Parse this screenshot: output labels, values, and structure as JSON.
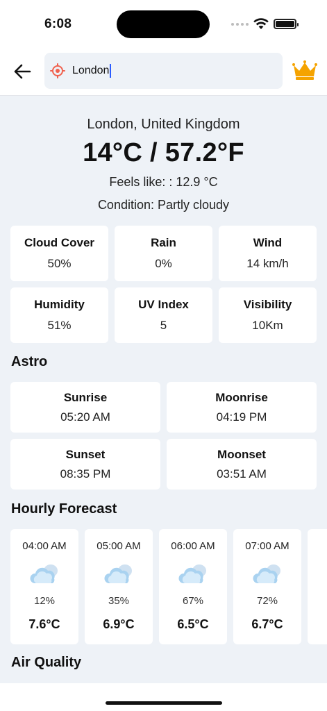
{
  "status": {
    "time": "6:08"
  },
  "search": {
    "value": "London"
  },
  "icons": {
    "back": "back-arrow-icon",
    "location": "location-target-icon",
    "crown": "crown-icon",
    "wifi": "wifi-icon",
    "battery": "battery-icon",
    "cloud": "partly-cloudy-icon"
  },
  "colors": {
    "accent": "#f5a300",
    "location": "#f0604d",
    "background": "#eef2f7"
  },
  "current": {
    "location": "London, United Kingdom",
    "temperature": "14°C / 57.2°F",
    "feels_like": "Feels like: : 12.9 °C",
    "condition": "Condition: Partly cloudy"
  },
  "metrics": [
    {
      "title": "Cloud Cover",
      "value": "50%"
    },
    {
      "title": "Rain",
      "value": "0%"
    },
    {
      "title": "Wind",
      "value": "14 km/h"
    },
    {
      "title": "Humidity",
      "value": "51%"
    },
    {
      "title": "UV Index",
      "value": "5"
    },
    {
      "title": "Visibility",
      "value": "10Km"
    }
  ],
  "astro": {
    "heading": "Astro",
    "items": [
      {
        "title": "Sunrise",
        "value": "05:20 AM"
      },
      {
        "title": "Moonrise",
        "value": "04:19 PM"
      },
      {
        "title": "Sunset",
        "value": "08:35 PM"
      },
      {
        "title": "Moonset",
        "value": "03:51 AM"
      }
    ]
  },
  "hourly": {
    "heading": "Hourly Forecast",
    "items": [
      {
        "time": "04:00 AM",
        "chance": "12%",
        "temp": "7.6°C"
      },
      {
        "time": "05:00 AM",
        "chance": "35%",
        "temp": "6.9°C"
      },
      {
        "time": "06:00 AM",
        "chance": "67%",
        "temp": "6.5°C"
      },
      {
        "time": "07:00 AM",
        "chance": "72%",
        "temp": "6.7°C"
      }
    ]
  },
  "air_quality": {
    "heading": "Air Quality"
  }
}
